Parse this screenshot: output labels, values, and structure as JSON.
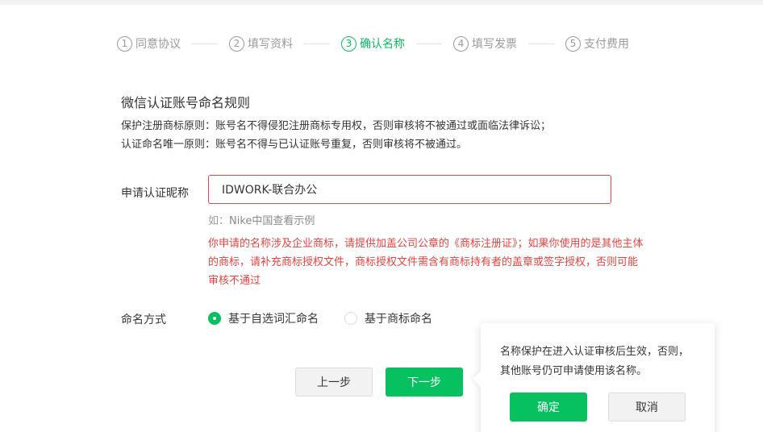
{
  "steps": [
    {
      "num": "1",
      "label": "同意协议",
      "active": false
    },
    {
      "num": "2",
      "label": "填写资料",
      "active": false
    },
    {
      "num": "3",
      "label": "确认名称",
      "active": true
    },
    {
      "num": "4",
      "label": "填写发票",
      "active": false
    },
    {
      "num": "5",
      "label": "支付费用",
      "active": false
    }
  ],
  "rules": {
    "title": "微信认证账号命名规则",
    "line1": "保护注册商标原则：账号名不得侵犯注册商标专用权，否则审核将不被通过或面临法律诉讼；",
    "line2": "认证命名唯一原则：账号名不得与已认证账号重复，否则审核将不被通过。"
  },
  "form": {
    "nickname_label": "申请认证昵称",
    "nickname_value": "IDWORK-联合办公",
    "hint_prefix": "如：",
    "hint_link": "Nike中国查看示例",
    "warning": "你申请的名称涉及企业商标，请提供加盖公司公章的《商标注册证》；如果你使用的是其他主体的商标，请补充商标授权文件，商标授权文件需含有商标持有者的盖章或签字授权，否则可能审核不通过",
    "method_label": "命名方式",
    "method_options": [
      {
        "label": "基于自选词汇命名",
        "checked": true
      },
      {
        "label": "基于商标命名",
        "checked": false
      }
    ]
  },
  "buttons": {
    "prev": "上一步",
    "next": "下一步"
  },
  "popover": {
    "text": "名称保护在进入认证审核后生效，否则，其他账号仍可申请使用该名称。",
    "confirm": "确定",
    "cancel": "取消"
  },
  "colors": {
    "accent": "#07c160",
    "error": "#e64340",
    "muted": "#9a9a9a"
  }
}
